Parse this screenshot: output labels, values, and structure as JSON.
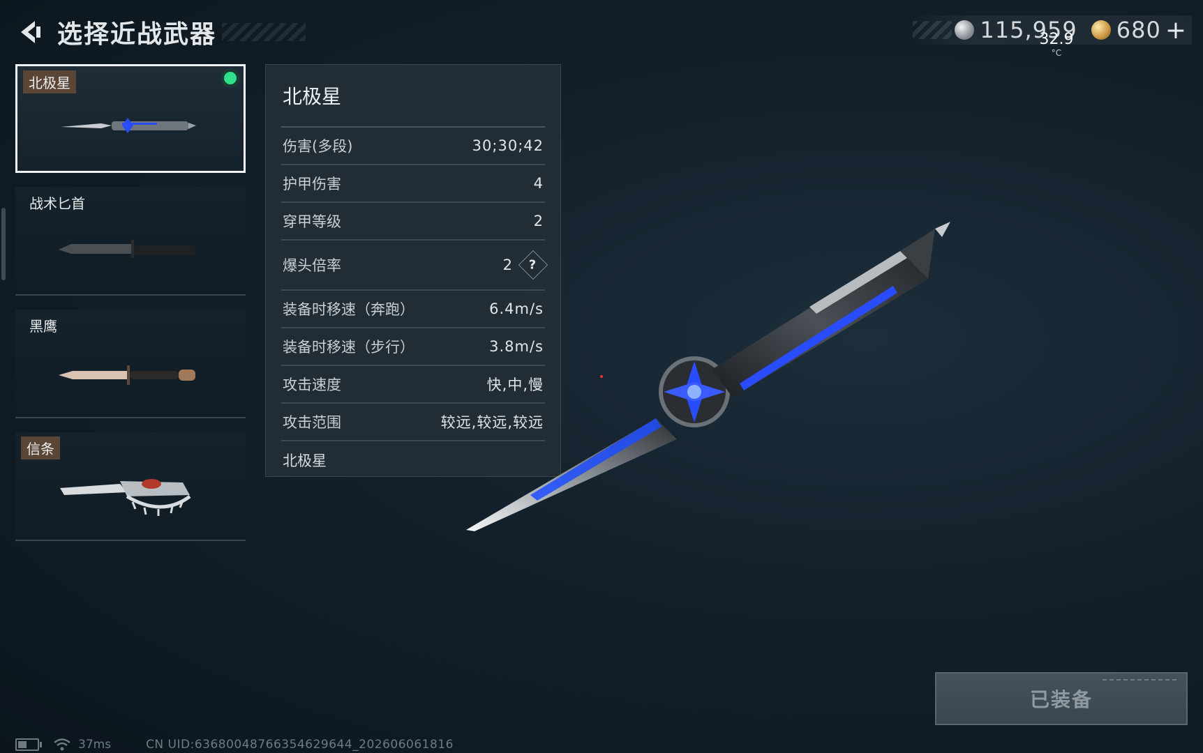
{
  "header": {
    "title": "选择近战武器"
  },
  "currency": {
    "silver": "115,959",
    "gold": "680",
    "plus": "+"
  },
  "overlay": {
    "temperature": "32.9",
    "unit": "°C"
  },
  "weapons": [
    {
      "name": "北极星",
      "selected": true,
      "equipped": true
    },
    {
      "name": "战术匕首",
      "selected": false
    },
    {
      "name": "黑鹰",
      "selected": false
    },
    {
      "name": "信条",
      "selected": false
    }
  ],
  "stats": {
    "title": "北极星",
    "rows": [
      {
        "label": "伤害(多段)",
        "value": "30;30;42"
      },
      {
        "label": "护甲伤害",
        "value": "4"
      },
      {
        "label": "穿甲等级",
        "value": "2"
      },
      {
        "label": "爆头倍率",
        "value": "2"
      },
      {
        "label": "装备时移速（奔跑）",
        "value": "6.4m/s"
      },
      {
        "label": "装备时移速（步行）",
        "value": "3.8m/s"
      },
      {
        "label": "攻击速度",
        "value": "快,中,慢"
      },
      {
        "label": "攻击范围",
        "value": "较远,较远,较远"
      }
    ],
    "help_symbol": "?",
    "footer": "北极星"
  },
  "equipped_button": "已装备",
  "status_bar": {
    "ping": "37ms",
    "uid": "CN UID:63680048766354629644_202606061816"
  },
  "colors": {
    "background": "#0e1820",
    "panel": "#242e36",
    "equipped_dot": "#2fe08a",
    "label_tag": "#5b4535",
    "blade_accent": "#2a4cff"
  }
}
